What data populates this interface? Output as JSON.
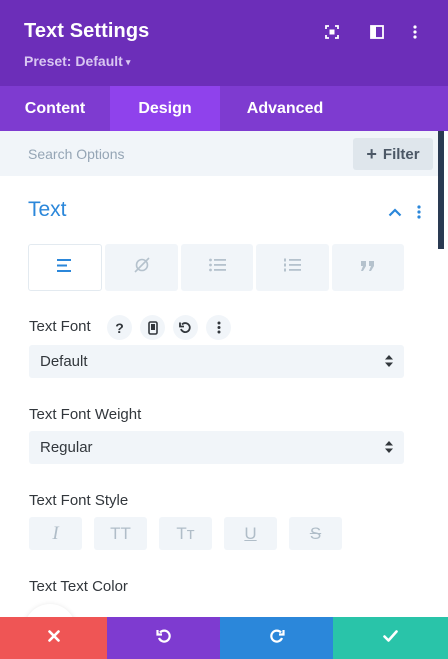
{
  "header": {
    "title": "Text Settings",
    "preset_label": "Preset: Default",
    "preset_caret": "▾",
    "icons": [
      "focus-icon",
      "split-view-icon",
      "more-vertical-icon"
    ]
  },
  "tabs": [
    {
      "label": "Content",
      "active": false
    },
    {
      "label": "Design",
      "active": true
    },
    {
      "label": "Advanced",
      "active": false
    }
  ],
  "search": {
    "placeholder": "Search Options",
    "filter_label": "Filter",
    "filter_icon": "+"
  },
  "section": {
    "title": "Text",
    "alignment_options": [
      "text-align-left-icon",
      "no-link-icon",
      "bulleted-list-icon",
      "numbered-list-icon",
      "blockquote-icon"
    ]
  },
  "fields": {
    "text_font": {
      "label": "Text Font",
      "help_glyph": "?",
      "value": "Default"
    },
    "text_font_weight": {
      "label": "Text Font Weight",
      "value": "Regular"
    },
    "text_font_style": {
      "label": "Text Font Style",
      "options": [
        {
          "glyph": "I",
          "name": "italic"
        },
        {
          "glyph": "TT",
          "name": "uppercase"
        },
        {
          "glyph": "Tт",
          "name": "small-caps"
        },
        {
          "glyph": "U",
          "name": "underline"
        },
        {
          "glyph": "S",
          "name": "strikethrough"
        }
      ]
    },
    "text_text_color": {
      "label": "Text Text Color"
    }
  },
  "footer": {
    "buttons": [
      "close-icon",
      "undo-icon",
      "redo-icon",
      "check-icon"
    ]
  },
  "colors": {
    "header_bg": "#6c2eb9",
    "tabs_bg": "#7e3bd0",
    "tab_active_bg": "#8f42ec",
    "accent_blue": "#2b87da",
    "cancel_red": "#ef5555",
    "undo_purple": "#7e3bd0",
    "redo_blue": "#2b87da",
    "save_green": "#29c4a9"
  }
}
